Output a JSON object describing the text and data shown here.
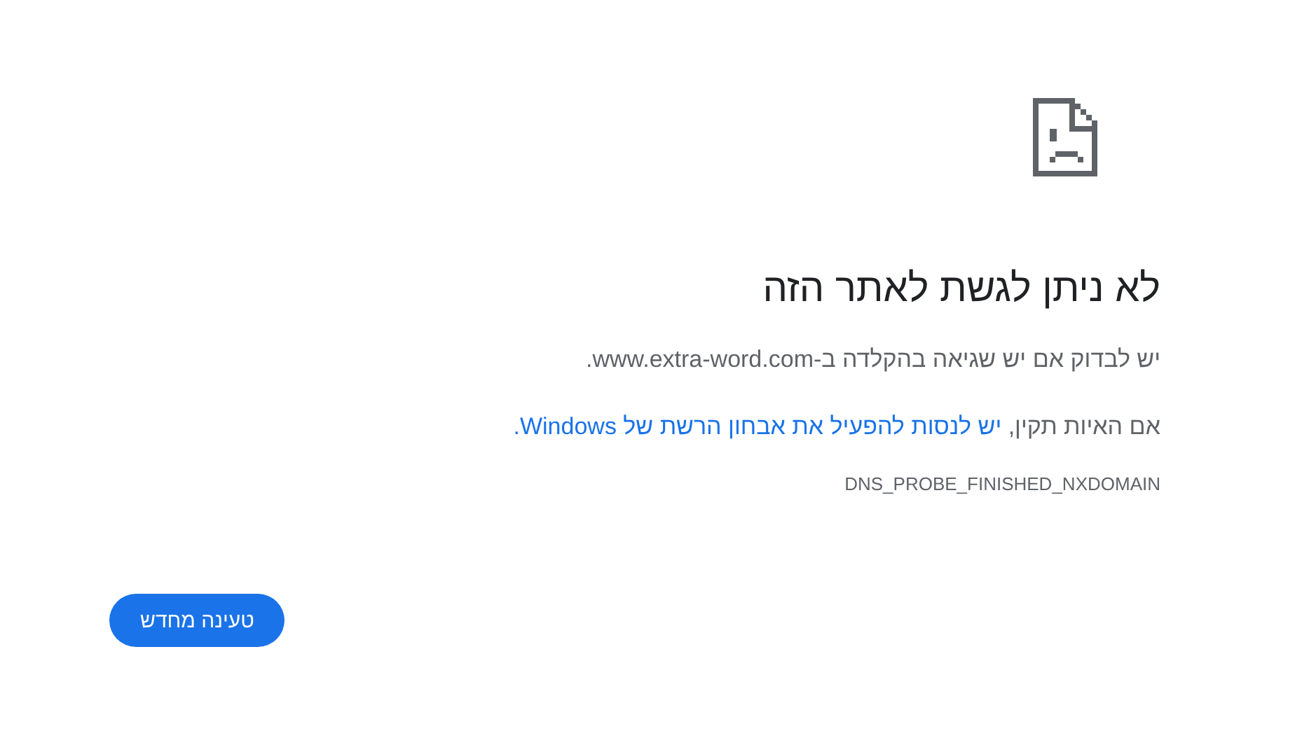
{
  "heading": "לא ניתן לגשת לאתר הזה",
  "message": "יש לבדוק אם יש שגיאה בהקלדה ב-www.extra-word.com.",
  "suggestion": {
    "text": "אם האיות תקין,",
    "link": "יש לנסות להפעיל את אבחון הרשת של Windows."
  },
  "error_code": "DNS_PROBE_FINISHED_NXDOMAIN",
  "buttons": [
    "טעינה מחדש"
  ]
}
